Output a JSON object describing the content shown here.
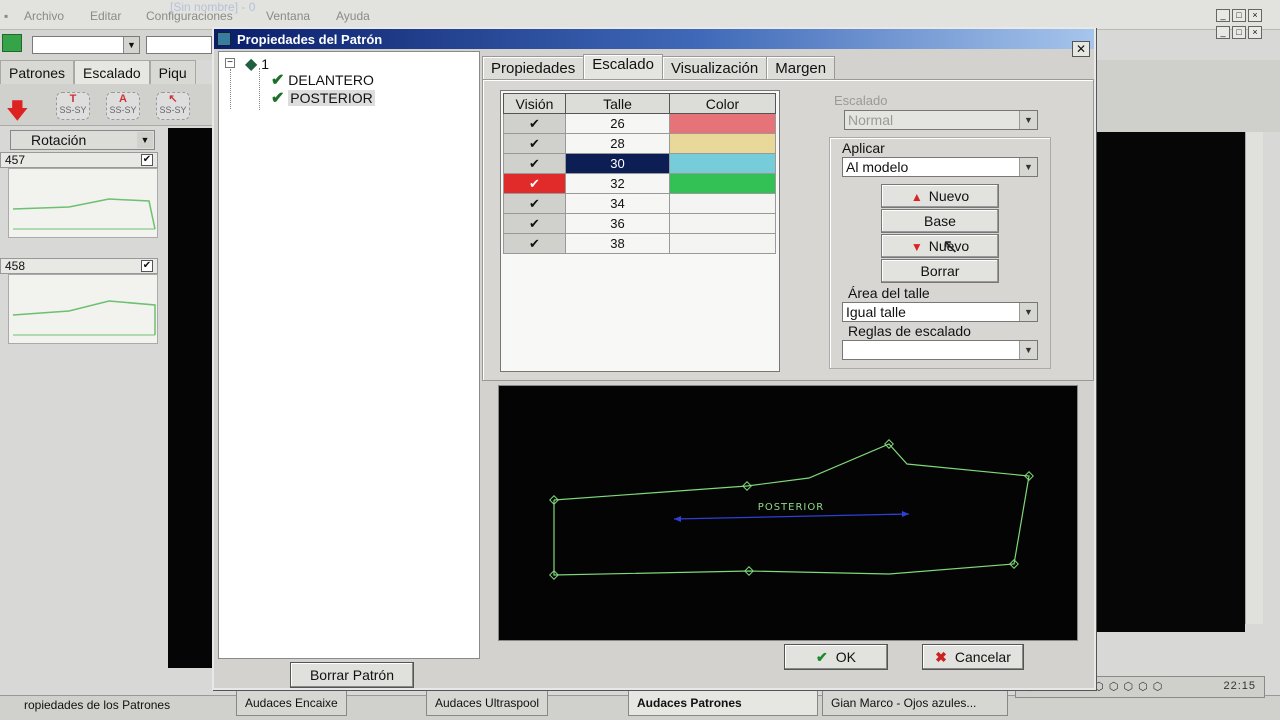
{
  "app": {
    "title": "[Sin nombre] - 0",
    "menu": [
      "Archivo",
      "Editar",
      "Configuraciones",
      "Ventana",
      "Ayuda"
    ],
    "tabs": [
      "Patrones",
      "Escalado",
      "Piqu"
    ],
    "rotation_label": "Rotación",
    "thumbnails": [
      {
        "label": "457"
      },
      {
        "label": "458"
      }
    ],
    "tool_letters": [
      "T",
      "A",
      ""
    ],
    "tool_caption": "SS-SY",
    "status_text": "ropiedades de los Patrones",
    "taskbar": [
      {
        "label": "Audaces Encaixe"
      },
      {
        "label": "Audaces Ultraspool"
      },
      {
        "label": "Audaces Patrones"
      },
      {
        "label": "Gian Marco - Ojos azules..."
      }
    ],
    "clock": "22:15"
  },
  "dialog": {
    "title": "Propiedades del Patrón",
    "close": "✕",
    "tree": {
      "root": "1",
      "items": [
        "DELANTERO",
        "POSTERIOR"
      ]
    },
    "delete_button": "Borrar Patrón",
    "tabs": [
      "Propiedades",
      "Escalado",
      "Visualización",
      "Margen"
    ],
    "active_tab": "Escalado",
    "table": {
      "headers": [
        "Visión",
        "Talle",
        "Color"
      ],
      "rows": [
        {
          "talle": "26",
          "vision": "✔",
          "color": "#e57378",
          "state": ""
        },
        {
          "talle": "28",
          "vision": "✔",
          "color": "#e8d99a",
          "state": ""
        },
        {
          "talle": "30",
          "vision": "✔",
          "color": "#76ccd8",
          "state": "selected"
        },
        {
          "talle": "32",
          "vision": "✔",
          "color": "#33c055",
          "state": "red"
        },
        {
          "talle": "34",
          "vision": "✔",
          "color": "#f4f4f2",
          "state": ""
        },
        {
          "talle": "36",
          "vision": "✔",
          "color": "#f4f4f2",
          "state": ""
        },
        {
          "talle": "38",
          "vision": "✔",
          "color": "#f4f4f2",
          "state": ""
        }
      ]
    },
    "escalado_label": "Escalado",
    "escalado_value": "Normal",
    "aplicar_label": "Aplicar",
    "aplicar_value": "Al modelo",
    "buttons": {
      "nuevo_up": "Nuevo",
      "base": "Base",
      "nuevo_down": "Nuevo",
      "borrar": "Borrar"
    },
    "area_label": "Área del talle",
    "area_value": "Igual talle",
    "reglas_label": "Reglas de escalado",
    "reglas_value": "",
    "preview_label": "POSTERIOR",
    "ok_label": "OK",
    "cancel_label": "Cancelar"
  }
}
